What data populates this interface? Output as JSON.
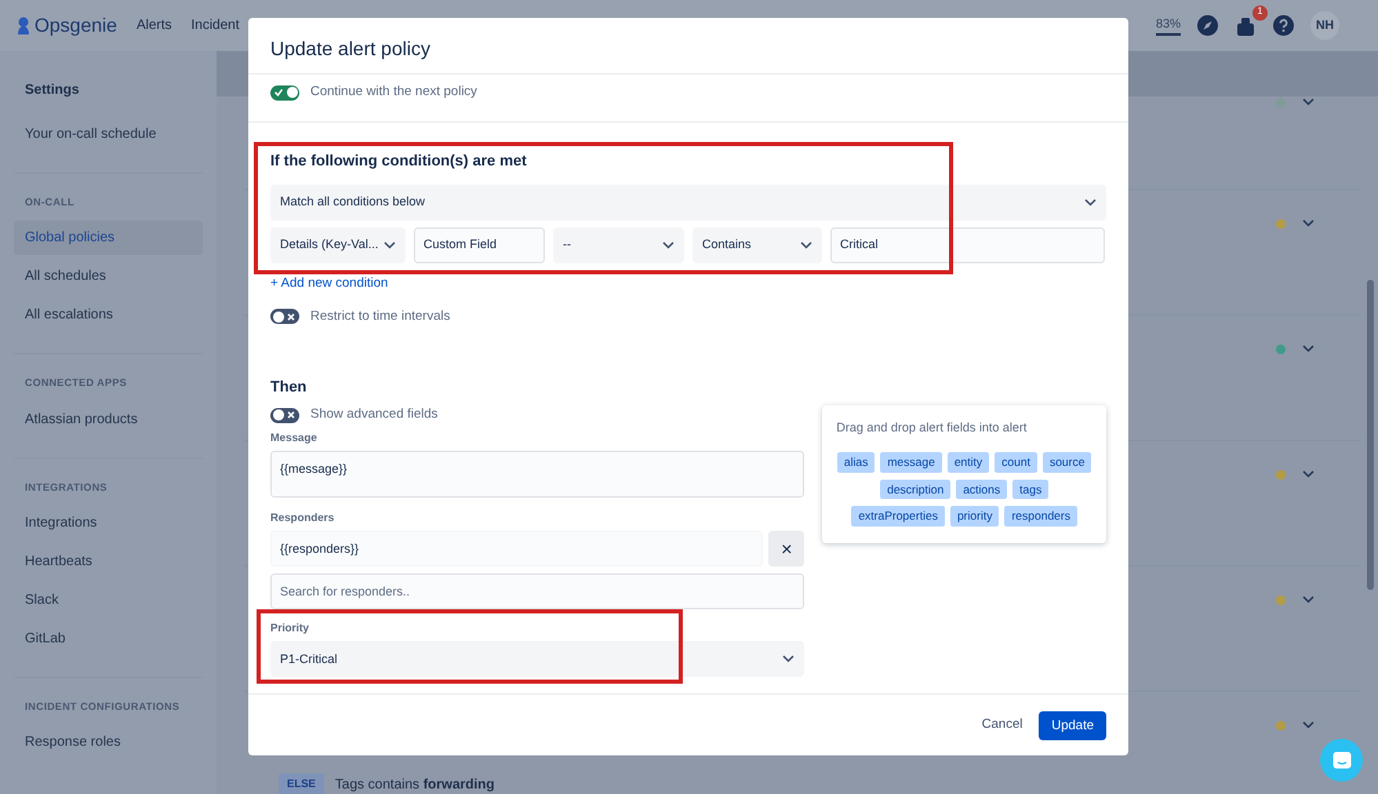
{
  "navbar": {
    "logo": "Opsgenie",
    "links": [
      "Alerts",
      "Incident"
    ],
    "usage": "83%",
    "notification_count": "1",
    "avatar": "NH"
  },
  "sidebar": {
    "title": "Settings",
    "top_items": [
      {
        "label": "Your on-call schedule",
        "selected": false
      }
    ],
    "sections": [
      {
        "heading": "ON-CALL",
        "items": [
          {
            "label": "Global policies",
            "selected": true
          },
          {
            "label": "All schedules",
            "selected": false
          },
          {
            "label": "All escalations",
            "selected": false
          }
        ]
      },
      {
        "heading": "CONNECTED APPS",
        "items": [
          {
            "label": "Atlassian products",
            "selected": false
          }
        ]
      },
      {
        "heading": "INTEGRATIONS",
        "items": [
          {
            "label": "Integrations",
            "selected": false
          },
          {
            "label": "Heartbeats",
            "selected": false
          },
          {
            "label": "Slack",
            "selected": false
          },
          {
            "label": "GitLab",
            "selected": false
          }
        ]
      },
      {
        "heading": "INCIDENT CONFIGURATIONS",
        "items": [
          {
            "label": "Response roles",
            "selected": false
          }
        ]
      }
    ]
  },
  "rule_rows": [
    {
      "color": "#7f9c98"
    },
    {
      "color": "#b39c45"
    },
    {
      "color": "#3f9c88"
    },
    {
      "color": "#b39c45"
    },
    {
      "color": "#b39c45"
    },
    {
      "color": "#b39c45",
      "badge": "ELSE",
      "text": "Tags contains **forwarding**"
    }
  ],
  "modal": {
    "title": "Update alert policy",
    "continue_toggle": {
      "label": "Continue with the next policy",
      "on": true
    },
    "conditions": {
      "heading": "If the following condition(s) are met",
      "match": "Match all conditions below",
      "row": [
        {
          "kind": "select",
          "value": "Details (Key-Val..."
        },
        {
          "kind": "input",
          "value": "Custom Field"
        },
        {
          "kind": "select",
          "value": "--"
        },
        {
          "kind": "select",
          "value": "Contains"
        },
        {
          "kind": "input",
          "value": "Critical"
        }
      ],
      "add_link": "+ Add new condition"
    },
    "restrict_toggle": {
      "label": "Restrict to time intervals",
      "on": false
    },
    "then": {
      "heading": "Then",
      "advanced_toggle": {
        "label": "Show advanced fields",
        "on": false
      },
      "message": {
        "label": "Message",
        "value": "{{message}}"
      },
      "responders": {
        "label": "Responders",
        "value": "{{responders}}",
        "clear": "×",
        "search_placeholder": "Search for responders.."
      },
      "priority": {
        "label": "Priority",
        "value": "P1-Critical"
      }
    },
    "fields_panel": {
      "title": "Drag and drop alert fields into alert",
      "tags": [
        "alias",
        "message",
        "entity",
        "count",
        "source",
        "description",
        "actions",
        "tags",
        "extraProperties",
        "priority",
        "responders"
      ]
    },
    "buttons": {
      "cancel": "Cancel",
      "update": "Update"
    }
  }
}
